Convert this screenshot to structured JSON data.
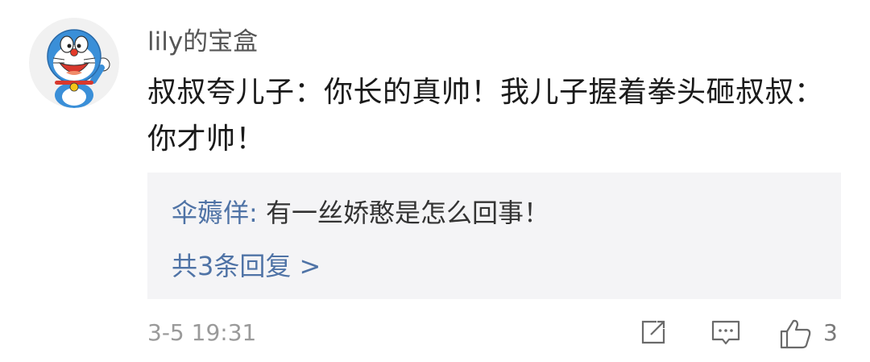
{
  "comment": {
    "username": "lily的宝盒",
    "text": "叔叔夸儿子：你长的真帅！我儿子握着拳头砸叔叔：你才帅！",
    "timestamp": "3-5 19:31",
    "like_count": "3"
  },
  "reply_preview": {
    "author": "伞薅佯",
    "colon": ": ",
    "text": "有一丝娇憨是怎么回事！",
    "count_label": "共3条回复 >"
  },
  "icons": {
    "avatar": "doraemon-avatar",
    "share": "share-edit-icon",
    "comment": "comment-bubble-icon",
    "like": "thumbs-up-icon"
  },
  "colors": {
    "link": "#4f73a6",
    "reply_background": "#f4f4f6",
    "meta": "#9a9a9a"
  }
}
